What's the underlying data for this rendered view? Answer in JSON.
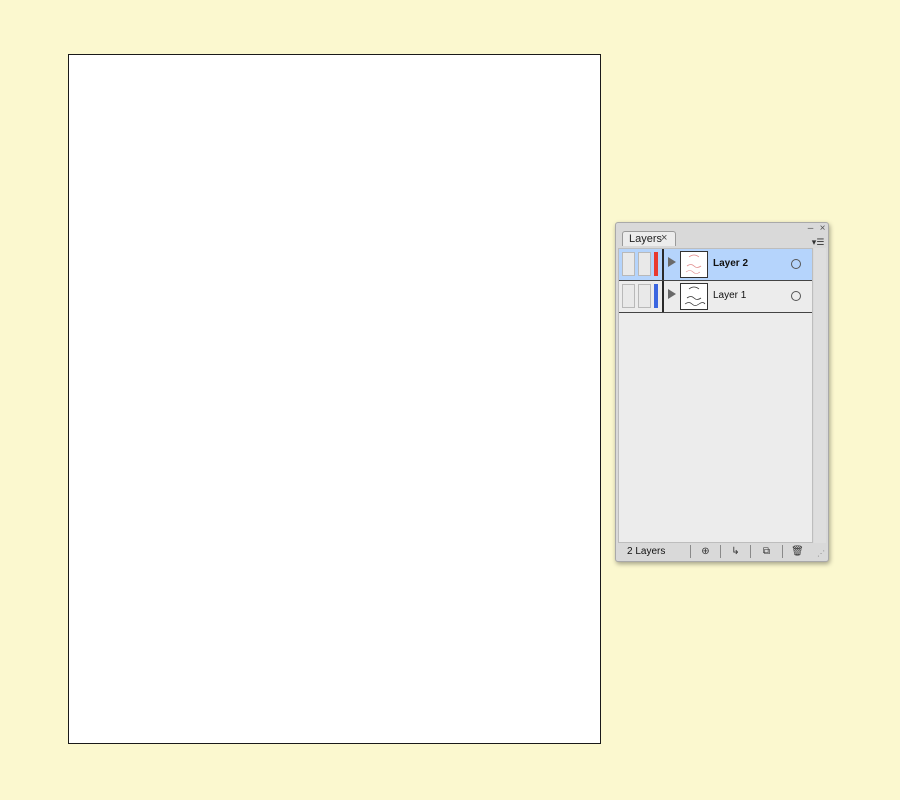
{
  "colors": {
    "workspace_background": "#fbf8cf",
    "selected_row": "#b5d4fc",
    "layer2_color": "#e8392f",
    "layer1_color": "#3b66e0"
  },
  "panel": {
    "tab_label": "Layers",
    "tab_close_glyph": "×",
    "minimize_glyph": "–",
    "close_glyph": "×",
    "menu_glyph": "▾☰",
    "layers": [
      {
        "name": "Layer 2",
        "selected": true
      },
      {
        "name": "Layer 1",
        "selected": false
      }
    ],
    "footer": {
      "layer_count": "2 Layers",
      "locate_icon": "⊕",
      "sublayer_icon": "↳",
      "new_layer_icon": "⧉",
      "delete_icon": "🗑",
      "grip": "⋰"
    }
  }
}
